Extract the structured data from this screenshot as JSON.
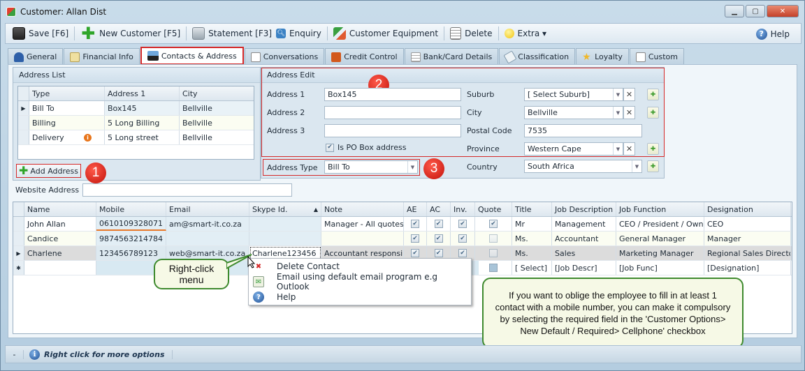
{
  "window": {
    "title": "Customer: Allan Dist",
    "minimize": "▁",
    "maximize": "▢",
    "close": "✕"
  },
  "toolbar": {
    "save": "Save [F6]",
    "new_customer": "New Customer [F5]",
    "statement": "Statement [F3]",
    "enquiry": "Enquiry",
    "customer_equipment": "Customer Equipment",
    "delete": "Delete",
    "extra": "Extra ▾",
    "help": "Help"
  },
  "tabs": [
    {
      "label": "General",
      "icon": "user-icon",
      "active": false
    },
    {
      "label": "Financial Info",
      "icon": "financial-icon",
      "active": false
    },
    {
      "label": "Contacts & Address",
      "icon": "contacts-icon",
      "active": true
    },
    {
      "label": "Conversations",
      "icon": "conversation-icon",
      "active": false
    },
    {
      "label": "Credit Control",
      "icon": "lock-icon",
      "active": false
    },
    {
      "label": "Bank/Card Details",
      "icon": "list-icon",
      "active": false
    },
    {
      "label": "Classification",
      "icon": "tag-icon",
      "active": false
    },
    {
      "label": "Loyalty",
      "icon": "star-icon",
      "active": false
    },
    {
      "label": "Custom",
      "icon": "chart-icon",
      "active": false
    }
  ],
  "address_list": {
    "title": "Address List",
    "columns": [
      "Type",
      "Address 1",
      "City"
    ],
    "rows": [
      {
        "type": "Bill To",
        "address1": "Box145",
        "city": "Bellville",
        "selected": true
      },
      {
        "type": "Billing",
        "address1": "5 Long Billing",
        "city": "Bellville"
      },
      {
        "type": "Delivery",
        "address1": "5 Long street",
        "city": "Bellville",
        "info_icon": true
      }
    ],
    "add_button": "Add Address"
  },
  "address_edit": {
    "title": "Address Edit",
    "address1_label": "Address 1",
    "address1": "Box145",
    "address2_label": "Address 2",
    "address2": "",
    "address3_label": "Address 3",
    "address3": "",
    "po_box_label": "Is PO Box address",
    "po_box_checked": true,
    "suburb_label": "Suburb",
    "suburb": "[ Select Suburb]",
    "city_label": "City",
    "city": "Bellville",
    "postal_code_label": "Postal Code",
    "postal_code": "7535",
    "province_label": "Province",
    "province": "Western Cape",
    "address_type_label": "Address Type",
    "address_type": "Bill To",
    "country_label": "Country",
    "country": "South Africa"
  },
  "website": {
    "label": "Website Address",
    "value": ""
  },
  "contacts": {
    "columns": [
      "Name",
      "Mobile",
      "Email",
      "Skype Id.",
      "Note",
      "AE",
      "AC",
      "Inv.",
      "Quote",
      "Title",
      "Job Description",
      "Job Function",
      "Designation"
    ],
    "sort_indicator": "▲",
    "rows": [
      {
        "name": "John Allan",
        "mobile": "0610109328071",
        "email": "am@smart-it.co.za",
        "skype": "",
        "note": "Manager - All quotes...",
        "ae": true,
        "ac": true,
        "inv": true,
        "quote": true,
        "title": "Mr",
        "job_description": "Management",
        "job_function": "CEO / President / Owner",
        "designation": "CEO"
      },
      {
        "name": "Candice",
        "mobile": "9874563214784",
        "email": "",
        "skype": "",
        "note": "",
        "ae": true,
        "ac": true,
        "inv": true,
        "quote": false,
        "title": "Ms.",
        "job_description": "Accountant",
        "job_function": "General Manager",
        "designation": "Manager"
      },
      {
        "name": "Charlene",
        "mobile": "123456789123",
        "email": "web@smart-it.co.za",
        "skype": "Charlene123456",
        "note": "Accountant responsi...",
        "ae": true,
        "ac": true,
        "inv": true,
        "quote": false,
        "title": "Ms.",
        "job_description": "Sales",
        "job_function": "Marketing Manager",
        "designation": "Regional Sales Director",
        "selected": true
      }
    ],
    "new_row": {
      "title": "[ Select]",
      "job_description": "[Job Descr]",
      "job_function": "[Job Func]",
      "designation": "[Designation]"
    }
  },
  "context_menu": {
    "items": [
      {
        "label": "Delete Contact",
        "icon": "delete-contact-icon"
      },
      {
        "label": "Email using default email program e.g Outlook",
        "icon": "email-icon"
      },
      {
        "label": "Help",
        "icon": "help-icon"
      }
    ]
  },
  "annotations": {
    "badges": [
      "1",
      "2",
      "3"
    ],
    "callout_menu": "Right-click menu",
    "callout_info": "If you want to oblige the employee to fill in at least 1 contact with a mobile number, you can make it compulsory by selecting the required field in the 'Customer Options> New Default / Required> Cellphone' checkbox"
  },
  "status_bar": {
    "dash": "-",
    "message": "Right click for more options"
  }
}
